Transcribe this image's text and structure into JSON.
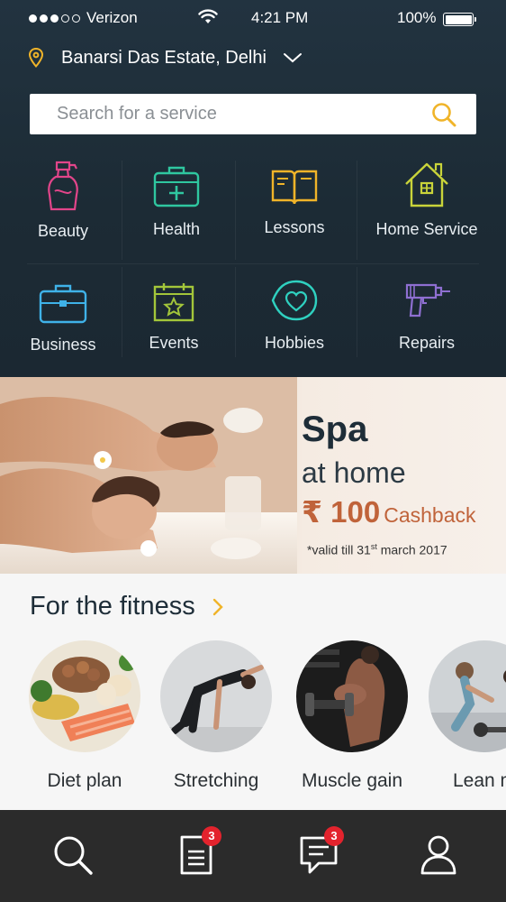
{
  "status_bar": {
    "carrier": "Verizon",
    "time": "4:21 PM",
    "battery": "100%"
  },
  "location": {
    "label": "Banarsi Das Estate, Delhi"
  },
  "search": {
    "placeholder": "Search for a service"
  },
  "categories": [
    {
      "label": "Beauty",
      "icon": "spray-bottle-icon",
      "color": "#e2458a"
    },
    {
      "label": "Health",
      "icon": "medical-kit-icon",
      "color": "#2fc7a0"
    },
    {
      "label": "Lessons",
      "icon": "book-icon",
      "color": "#f0b429"
    },
    {
      "label": "Home Service",
      "icon": "house-icon",
      "color": "#c9d43a"
    },
    {
      "label": "Business",
      "icon": "briefcase-icon",
      "color": "#3fb2e8"
    },
    {
      "label": "Events",
      "icon": "calendar-star-icon",
      "color": "#a3c63a"
    },
    {
      "label": "Hobbies",
      "icon": "heart-bubble-icon",
      "color": "#2fd1c0"
    },
    {
      "label": "Repairs",
      "icon": "drill-icon",
      "color": "#8e6fd1"
    }
  ],
  "banner": {
    "title": "Spa",
    "subtitle": "at home",
    "amount": "₹ 100",
    "cashback": "Cashback",
    "valid_prefix": "*valid till 31",
    "valid_sup": "st",
    "valid_suffix": " march 2017"
  },
  "fitness": {
    "title": "For the fitness",
    "items": [
      {
        "label": "Diet plan"
      },
      {
        "label": "Stretching"
      },
      {
        "label": "Muscle gain"
      },
      {
        "label": "Lean m"
      }
    ]
  },
  "tabbar": {
    "items": [
      {
        "icon": "search-icon",
        "badge": ""
      },
      {
        "icon": "document-icon",
        "badge": "3"
      },
      {
        "icon": "chat-icon",
        "badge": "3"
      },
      {
        "icon": "profile-icon",
        "badge": ""
      }
    ]
  },
  "colors": {
    "panel": "#1f2e38",
    "accent": "#f0b429",
    "cashback": "#c0633a",
    "badge": "#e3232d"
  }
}
